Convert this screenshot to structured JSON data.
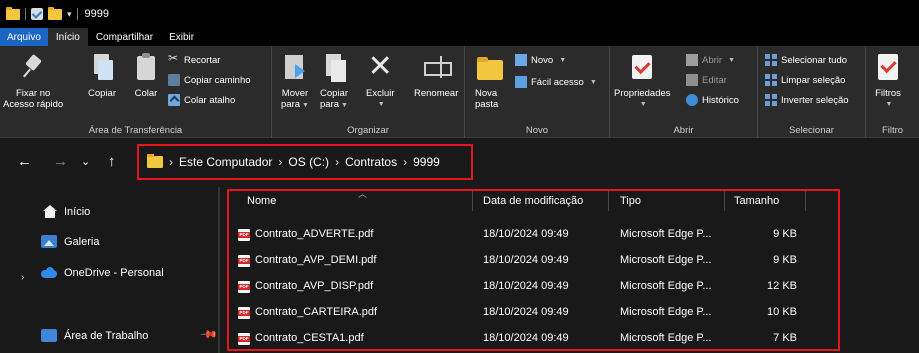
{
  "window": {
    "title": "9999"
  },
  "tabs": [
    "Arquivo",
    "Início",
    "Compartilhar",
    "Exibir"
  ],
  "ribbon": {
    "clipboard": {
      "label": "Área de Transferência",
      "pin": [
        "Fixar no",
        "Acesso rápido"
      ],
      "copy": "Copiar",
      "paste": "Colar",
      "cut": "Recortar",
      "copy_path": "Copiar caminho",
      "paste_shortcut": "Colar atalho"
    },
    "organize": {
      "label": "Organizar",
      "move_to": [
        "Mover",
        "para"
      ],
      "copy_to": [
        "Copiar",
        "para"
      ],
      "delete": "Excluir",
      "rename": "Renomear"
    },
    "new": {
      "label": "Novo",
      "new_folder": [
        "Nova",
        "pasta"
      ],
      "new_item": "Novo",
      "easy_access": "Fácil acesso"
    },
    "open": {
      "label": "Abrir",
      "properties": "Propriedades",
      "open": "Abrir",
      "edit": "Editar",
      "history": "Histórico"
    },
    "select": {
      "label": "Selecionar",
      "select_all": "Selecionar tudo",
      "select_none": "Limpar seleção",
      "invert": "Inverter seleção"
    },
    "filter": {
      "label": "Filtro",
      "filters": "Filtros"
    }
  },
  "address": {
    "crumbs": [
      "Este Computador",
      "OS (C:)",
      "Contratos",
      "9999"
    ]
  },
  "sidebar": {
    "items": [
      "Início",
      "Galeria",
      "OneDrive - Personal",
      "Área de Trabalho"
    ]
  },
  "files": {
    "columns": [
      "Nome",
      "Data de modificação",
      "Tipo",
      "Tamanho"
    ],
    "rows": [
      {
        "name": "Contrato_ADVERTE.pdf",
        "date": "18/10/2024 09:49",
        "type": "Microsoft Edge P...",
        "size": "9 KB"
      },
      {
        "name": "Contrato_AVP_DEMI.pdf",
        "date": "18/10/2024 09:49",
        "type": "Microsoft Edge P...",
        "size": "9 KB"
      },
      {
        "name": "Contrato_AVP_DISP.pdf",
        "date": "18/10/2024 09:49",
        "type": "Microsoft Edge P...",
        "size": "12 KB"
      },
      {
        "name": "Contrato_CARTEIRA.pdf",
        "date": "18/10/2024 09:49",
        "type": "Microsoft Edge P...",
        "size": "10 KB"
      },
      {
        "name": "Contrato_CESTA1.pdf",
        "date": "18/10/2024 09:49",
        "type": "Microsoft Edge P...",
        "size": "7 KB"
      }
    ]
  },
  "colors": {
    "highlight_border": "#e8121d",
    "file_tab": "#1a64c3",
    "folder": "#f3c640",
    "background": "#191919",
    "ribbon": "#2b2b2b"
  }
}
